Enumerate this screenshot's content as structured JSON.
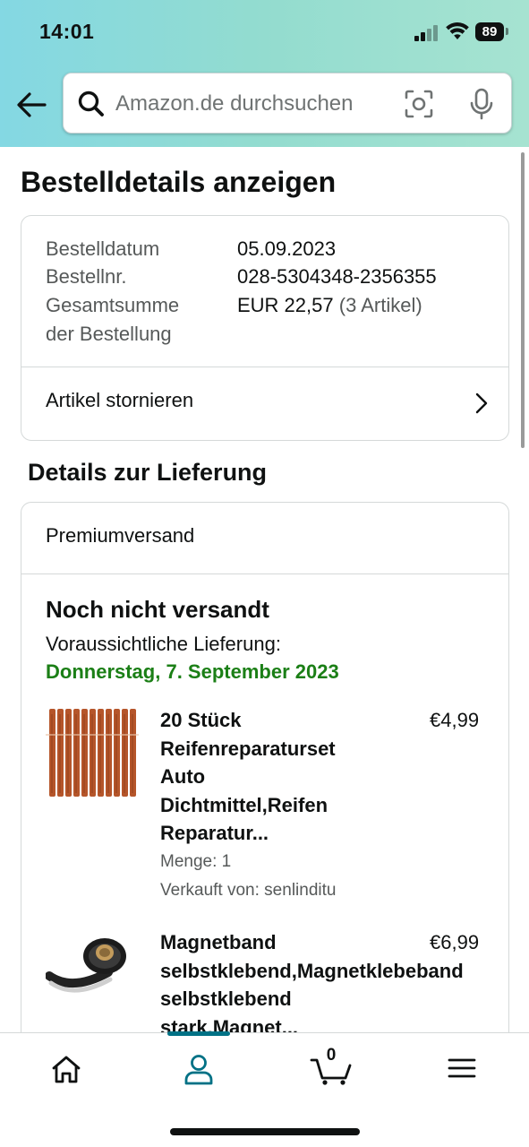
{
  "status_bar": {
    "time": "14:01",
    "battery": "89"
  },
  "search": {
    "placeholder": "Amazon.de durchsuchen"
  },
  "page": {
    "title": "Bestelldetails anzeigen"
  },
  "order_summary": {
    "date_label": "Bestelldatum",
    "date_value": "05.09.2023",
    "number_label": "Bestellnr.",
    "number_value": "028-5304348-2356355",
    "total_label_line1": "Gesamtsumme",
    "total_label_line2": "der Bestellung",
    "total_value": "EUR 22,57",
    "total_items": "(3 Artikel)",
    "cancel_link": "Artikel stornieren"
  },
  "delivery": {
    "section_title": "Details zur Lieferung",
    "shipping_method": "Premiumversand",
    "status": "Noch nicht versandt",
    "eta_label": "Voraussichtliche Lieferung:",
    "eta_date": "Donnerstag, 7. September 2023"
  },
  "items": [
    {
      "title_lines": [
        "20 Stück",
        "Reifenreparaturset",
        "Auto",
        "Dichtmittel,Reifen",
        "Reparatur..."
      ],
      "price": "€4,99",
      "quantity": "Menge: 1",
      "seller": "Verkauft von: senlinditu"
    },
    {
      "title_lines": [
        "Magnetband",
        "selbstklebend,Magnetklebeband",
        "selbstklebend",
        "stark,Magnet..."
      ],
      "price": "€6,99"
    }
  ],
  "tabbar": {
    "cart_count": "0",
    "active_tab": "account"
  },
  "colors": {
    "accent": "#007185",
    "eta_green": "#1b7f16",
    "header_start": "#84d8e3",
    "header_end": "#a6e3d1"
  },
  "icons": [
    "back-arrow-icon",
    "search-icon",
    "camera-icon",
    "microphone-icon",
    "chevron-right-icon",
    "home-icon",
    "account-icon",
    "cart-icon",
    "menu-icon"
  ]
}
